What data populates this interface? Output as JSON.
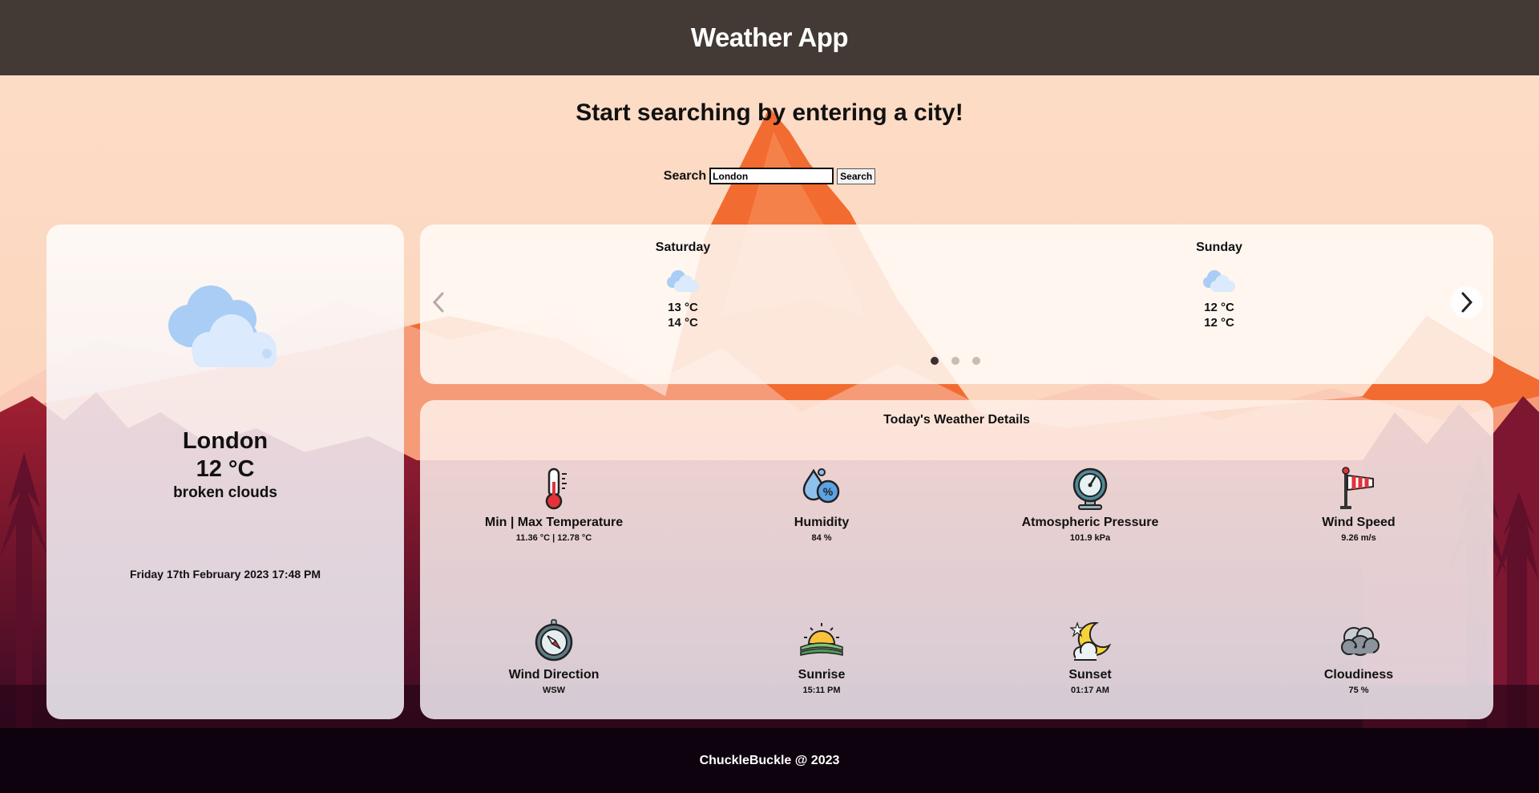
{
  "header": {
    "title": "Weather App"
  },
  "prompt": "Start searching by entering a city!",
  "search": {
    "label": "Search",
    "value": "London",
    "button_label": "Search"
  },
  "current": {
    "icon": "broken-clouds-icon",
    "city": "London",
    "temp": "12 °C",
    "description": "broken clouds",
    "datetime": "Friday 17th February 2023 17:48 PM"
  },
  "forecast": {
    "days": [
      {
        "name": "Saturday",
        "icon": "cloud-icon",
        "min": "13 °C",
        "max": "14 °C"
      },
      {
        "name": "Sunday",
        "icon": "cloud-icon",
        "min": "12 °C",
        "max": "12 °C"
      }
    ],
    "page_count": 3,
    "active_page": 1
  },
  "details": {
    "title": "Today's Weather Details",
    "metrics": [
      {
        "icon": "thermometer-icon",
        "label": "Min | Max Temperature",
        "value": "11.36 °C | 12.78 °C"
      },
      {
        "icon": "humidity-icon",
        "label": "Humidity",
        "value": "84 %"
      },
      {
        "icon": "pressure-gauge-icon",
        "label": "Atmospheric Pressure",
        "value": "101.9 kPa"
      },
      {
        "icon": "windsock-icon",
        "label": "Wind Speed",
        "value": "9.26 m/s"
      },
      {
        "icon": "compass-icon",
        "label": "Wind Direction",
        "value": "WSW"
      },
      {
        "icon": "sunrise-icon",
        "label": "Sunrise",
        "value": "15:11 PM"
      },
      {
        "icon": "moon-night-icon",
        "label": "Sunset",
        "value": "01:17 AM"
      },
      {
        "icon": "cloudy-rain-icon",
        "label": "Cloudiness",
        "value": "75 %"
      }
    ]
  },
  "footer": {
    "text": "ChuckleBuckle @ 2023"
  },
  "colors": {
    "header_bg": "#433935",
    "footer_bg": "#0f020f",
    "sky": "#fcd9c2",
    "mountain": "#f26b30",
    "forest": "#8a1a2e"
  }
}
